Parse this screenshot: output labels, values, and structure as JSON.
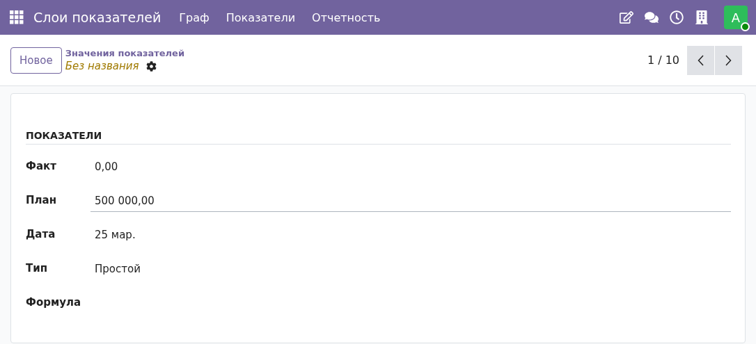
{
  "navbar": {
    "app_title": "Слои показателей",
    "menu": [
      "Граф",
      "Показатели",
      "Отчетность"
    ],
    "avatar": {
      "letter": "A",
      "online": true
    }
  },
  "control_panel": {
    "new_button": "Новое",
    "breadcrumb": "Значения показателей",
    "record_name": "Без названия",
    "pager": "1 / 10"
  },
  "form": {
    "section_title": "ПОКАЗАТЕЛИ",
    "fields": [
      {
        "label": "Факт",
        "value": "0,00",
        "focused": false
      },
      {
        "label": "План",
        "value": "500 000,00",
        "focused": true
      },
      {
        "label": "Дата",
        "value": "25 мар.",
        "focused": false
      },
      {
        "label": "Тип",
        "value": "Простой",
        "focused": false
      },
      {
        "label": "Формула",
        "focused": false
      }
    ]
  }
}
